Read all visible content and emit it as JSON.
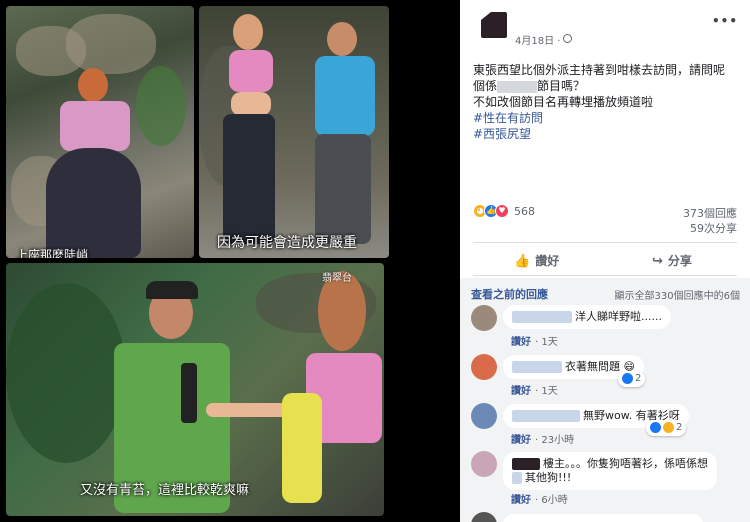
{
  "photos": {
    "caption_2": "因為可能會造成更嚴重",
    "caption_1": "上座那麼陡峭",
    "caption_3": "又沒有青苔，這裡比較乾爽嘛",
    "logo": "翡翠台"
  },
  "post": {
    "date": "4月18日 ·",
    "line1": "東張西望比個外派主持著到咁樣去訪問，請問呢",
    "line2_pre": "個係",
    "line2_post": "節目嗎？",
    "line3": "不如改個節目名再轉埋播放頻道啦",
    "hashtag1": "#性在有訪問",
    "hashtag2": "#西張尻望",
    "reaction_count": "568",
    "comments_count": "373個回應",
    "shares_count": "59次分享",
    "like_label": "讚好",
    "share_label": "分享",
    "more_icon": "more-dots-icon",
    "colors": {
      "link": "#385898",
      "like": "#1877f2",
      "love": "#f33e58",
      "haha": "#f7b125"
    }
  },
  "comments": {
    "view_previous": "查看之前的回應",
    "show_all": "顯示全部330個回應中的6個",
    "items": [
      {
        "text": "洋人睇咩野啦......",
        "reply": "讚好",
        "time": "· 1天",
        "reaction": ""
      },
      {
        "text": "衣著無問題",
        "reply": "讚好",
        "time": "· 1天",
        "reaction": "2"
      },
      {
        "text": "無野wow. 有著衫呀",
        "reply": "讚好",
        "time": "· 23小時",
        "reaction": "2"
      },
      {
        "text_l1": "樓主。。。你隻狗唔著衫，係唔係想",
        "text_l2": "其他狗!!!",
        "reply": "讚好",
        "time": "· 6小時",
        "reaction": ""
      }
    ]
  }
}
